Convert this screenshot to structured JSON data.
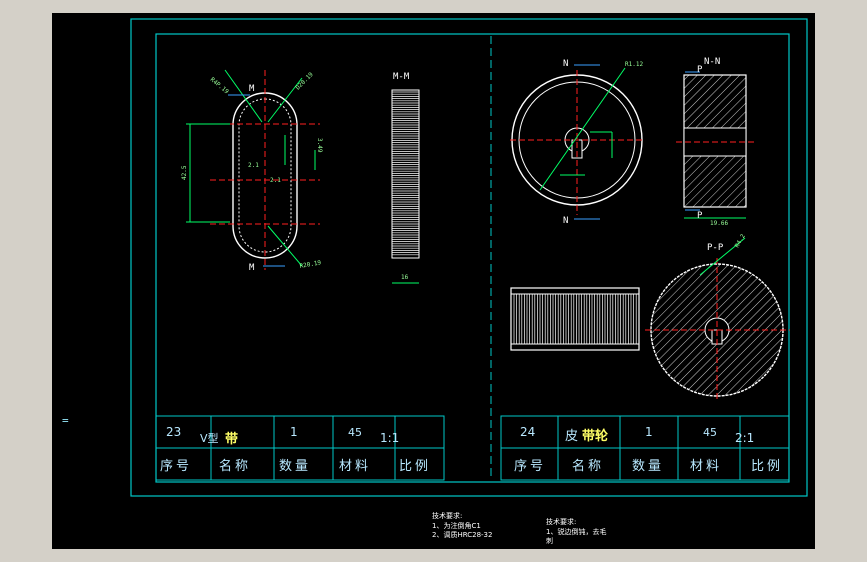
{
  "side_mark": "=",
  "views": {
    "left_section_label": "M-M",
    "left_width_dim": "16",
    "belt_dims": [
      "R4P.19",
      "R4.2",
      "2.1",
      "2.1",
      "42.5",
      "3.49",
      "D20.19",
      "R20.19"
    ],
    "belt_section_marks": [
      "M",
      "M"
    ],
    "pulley_marks": [
      "N",
      "N"
    ],
    "pulley_dim": "R1.12",
    "pulley_section_label": "N-N",
    "pulley_p_marks": [
      "P",
      "P"
    ],
    "pulley_width_dim": "19.66",
    "pp_section_label": "P-P",
    "pp_dim": "R4.2"
  },
  "table_left": {
    "row1": {
      "no": "23",
      "name_a": "V型",
      "name_b": "带",
      "qty": "1",
      "material": "45",
      "scale": "1:1"
    },
    "headers": [
      "序号",
      "名称",
      "数量",
      "材料",
      "比例"
    ]
  },
  "table_right": {
    "row1": {
      "no": "24",
      "name_a": "皮",
      "name_b": "带轮",
      "qty": "1",
      "material": "45",
      "scale": "2:1"
    },
    "headers": [
      "序号",
      "名称",
      "数量",
      "材料",
      "比例"
    ]
  },
  "notes_left": {
    "title": "技术要求:",
    "line1": "1、为注倒角C1",
    "line2": "2、调质HRC28-32"
  },
  "notes_right": {
    "title": "技术要求:",
    "line1": "1、锐边倒钝，去毛",
    "line2": "刺"
  },
  "colors": {
    "frame": "#00c8c8",
    "red_axis": "#ff2020",
    "dim": "#00ff66",
    "blue": "#3aa0ff",
    "white": "#ffffff"
  }
}
